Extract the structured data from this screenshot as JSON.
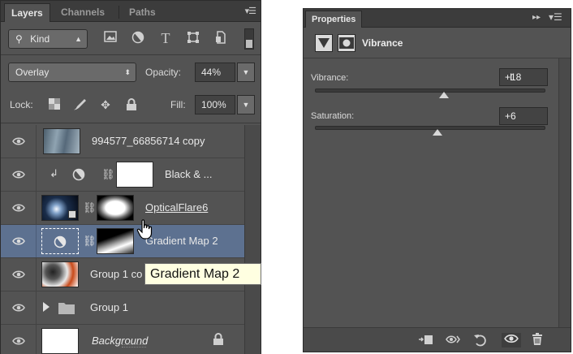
{
  "layers_panel": {
    "tabs": [
      "Layers",
      "Channels",
      "Paths"
    ],
    "filter": {
      "label": "Kind"
    },
    "blend_mode": "Overlay",
    "opacity_label": "Opacity:",
    "opacity_value": "44%",
    "lock_label": "Lock:",
    "fill_label": "Fill:",
    "fill_value": "100%",
    "layers": [
      {
        "name": "994577_66856714 copy",
        "italic": false
      },
      {
        "name": "Black & ...",
        "italic": false
      },
      {
        "name": "OpticalFlare6",
        "italic": false
      },
      {
        "name": "Gradient Map 2",
        "italic": false,
        "selected": true
      },
      {
        "name": "Group 1 co",
        "italic": false
      },
      {
        "name": "Group 1",
        "italic": false
      },
      {
        "name": "Background",
        "italic": true
      }
    ],
    "tooltip": "Gradient Map 2",
    "colors": {
      "panel": "#535353",
      "selected_row": "#5d7190",
      "tooltip_bg": "#ffffe1"
    }
  },
  "properties_panel": {
    "title": "Properties",
    "adjustment_name": "Vibrance",
    "vibrance_label": "Vibrance:",
    "vibrance_value": "+18",
    "vibrance_slider": 0.56,
    "saturation_label": "Saturation:",
    "saturation_value": "+6",
    "saturation_slider": 0.53,
    "footer_icons": [
      "clip-to-layer-icon",
      "view-previous-state-icon",
      "reset-icon",
      "toggle-visibility-icon",
      "delete-icon"
    ]
  }
}
